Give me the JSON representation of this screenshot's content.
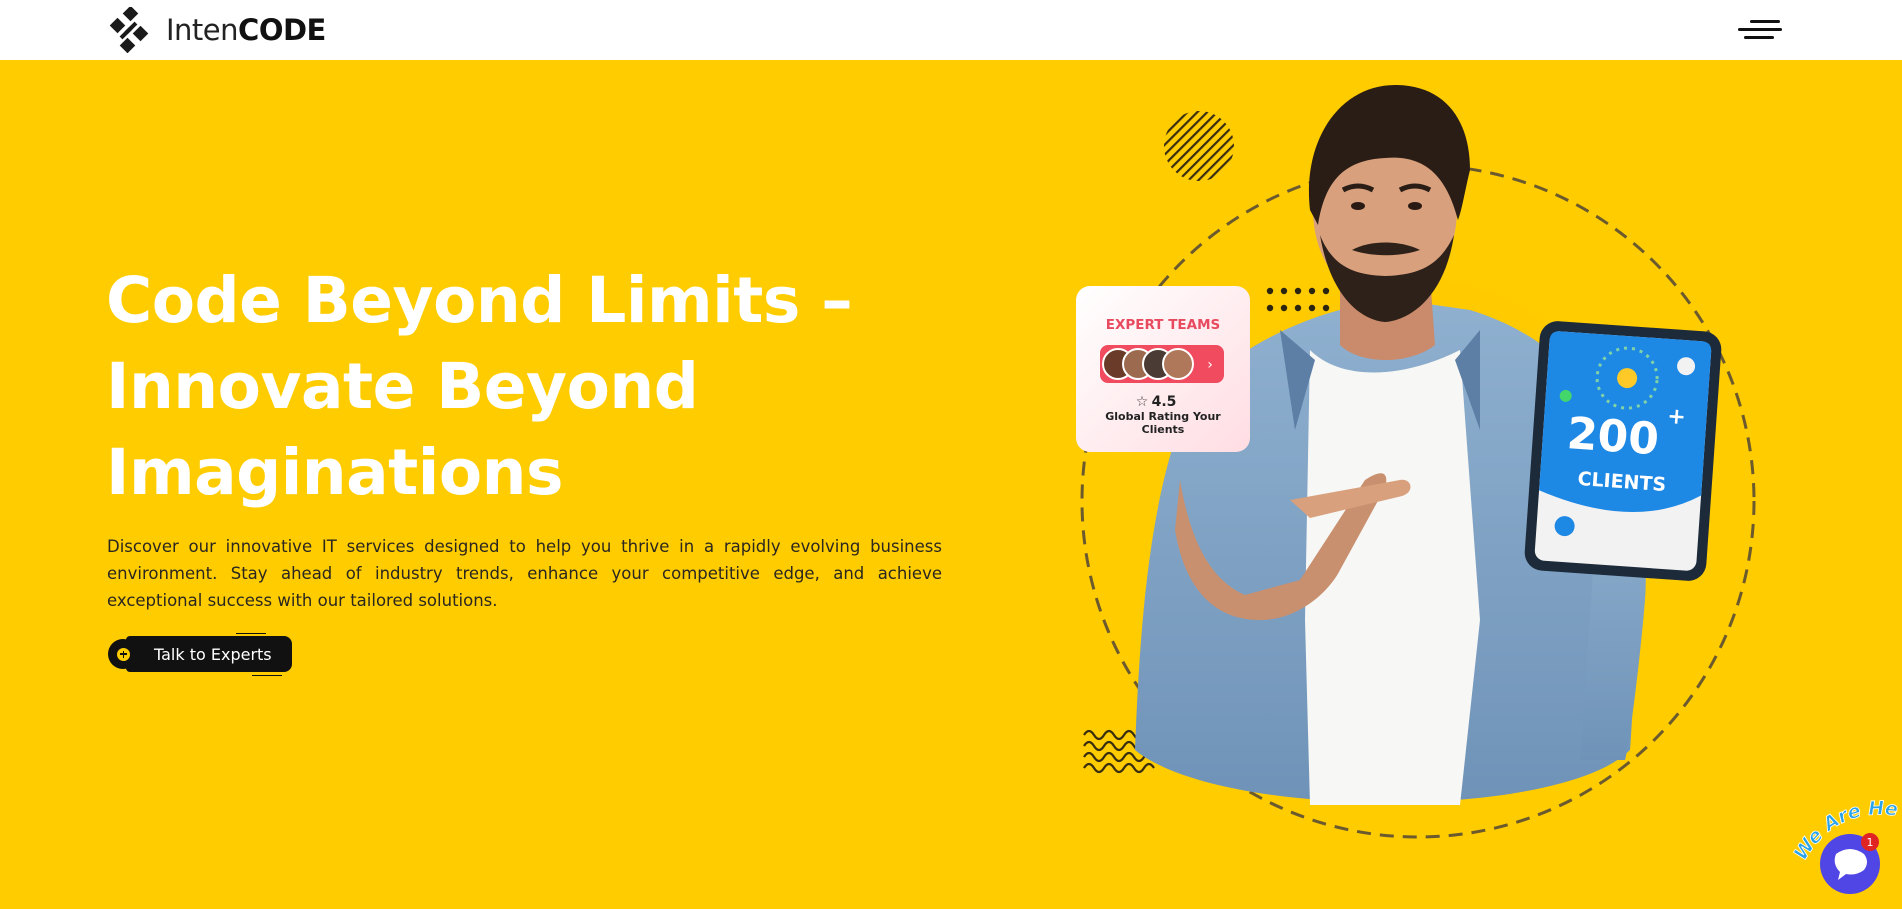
{
  "brand": {
    "name_light": "Inten",
    "name_bold": "CODE"
  },
  "nav": {
    "menu_icon": "hamburger-menu-icon"
  },
  "hero": {
    "headline": [
      "Code Beyond Limits –",
      "Innovate Beyond",
      "Imaginations"
    ],
    "lead": "Discover our innovative IT services designed to help you thrive in a rapidly evolving business environment. Stay ahead of industry trends, enhance your competitive edge, and achieve exceptional success with our tailored solutions.",
    "cta_label": "Talk to Experts",
    "cta_icon": "plus-circle-icon"
  },
  "expert_card": {
    "title": "EXPERT TEAMS",
    "rating": "4.5",
    "caption": "Global Rating Your Clients",
    "rating_icon": "star-icon",
    "arrow_icon": "chevron-right-icon"
  },
  "tablet": {
    "number": "200",
    "suffix": "+",
    "label": "CLIENTS"
  },
  "chat_widget": {
    "badge_text": "We Are Here!",
    "unread_count": "1",
    "icon": "chat-bubble-icon"
  },
  "colors": {
    "background": "#ffcc00",
    "text_dark": "#111111",
    "accent_blue": "#1e88e5",
    "card_red": "#ef4444"
  }
}
